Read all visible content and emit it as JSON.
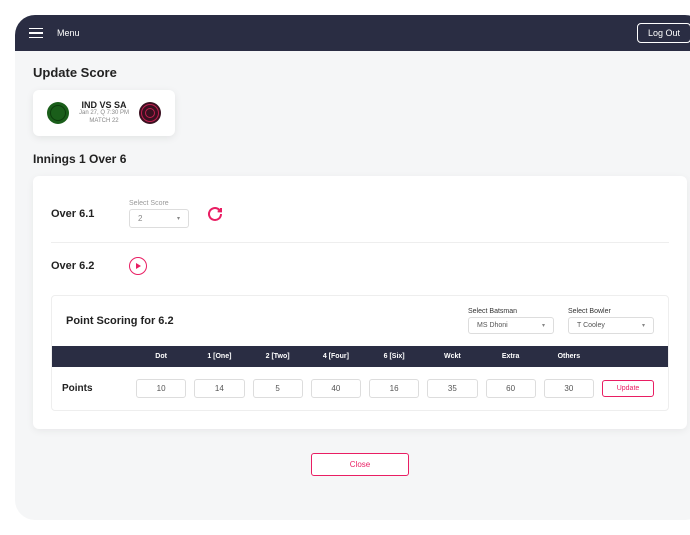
{
  "topbar": {
    "menu_label": "Menu",
    "logout_label": "Log Out"
  },
  "page_title": "Update Score",
  "match": {
    "title": "IND VS SA",
    "date": "Jan 27, Q 7:30 PM",
    "match_num": "MATCH 22"
  },
  "innings_title": "Innings 1 Over 6",
  "overs": [
    {
      "label": "Over 6.1",
      "select_label": "Select Score",
      "value": "2",
      "action": "refresh"
    },
    {
      "label": "Over 6.2",
      "action": "play"
    }
  ],
  "scoring": {
    "title": "Point Scoring for 6.2",
    "batsman_label": "Select Batsman",
    "batsman_value": "MS Dhoni",
    "bowler_label": "Select Bowler",
    "bowler_value": "T Cooley",
    "headers": [
      "Dot",
      "1 [One]",
      "2 [Two]",
      "4 [Four]",
      "6 [Six]",
      "Wckt",
      "Extra",
      "Others"
    ],
    "points_label": "Points",
    "points": [
      "10",
      "14",
      "5",
      "40",
      "16",
      "35",
      "60",
      "30"
    ],
    "update_label": "Update"
  },
  "close_label": "Close"
}
